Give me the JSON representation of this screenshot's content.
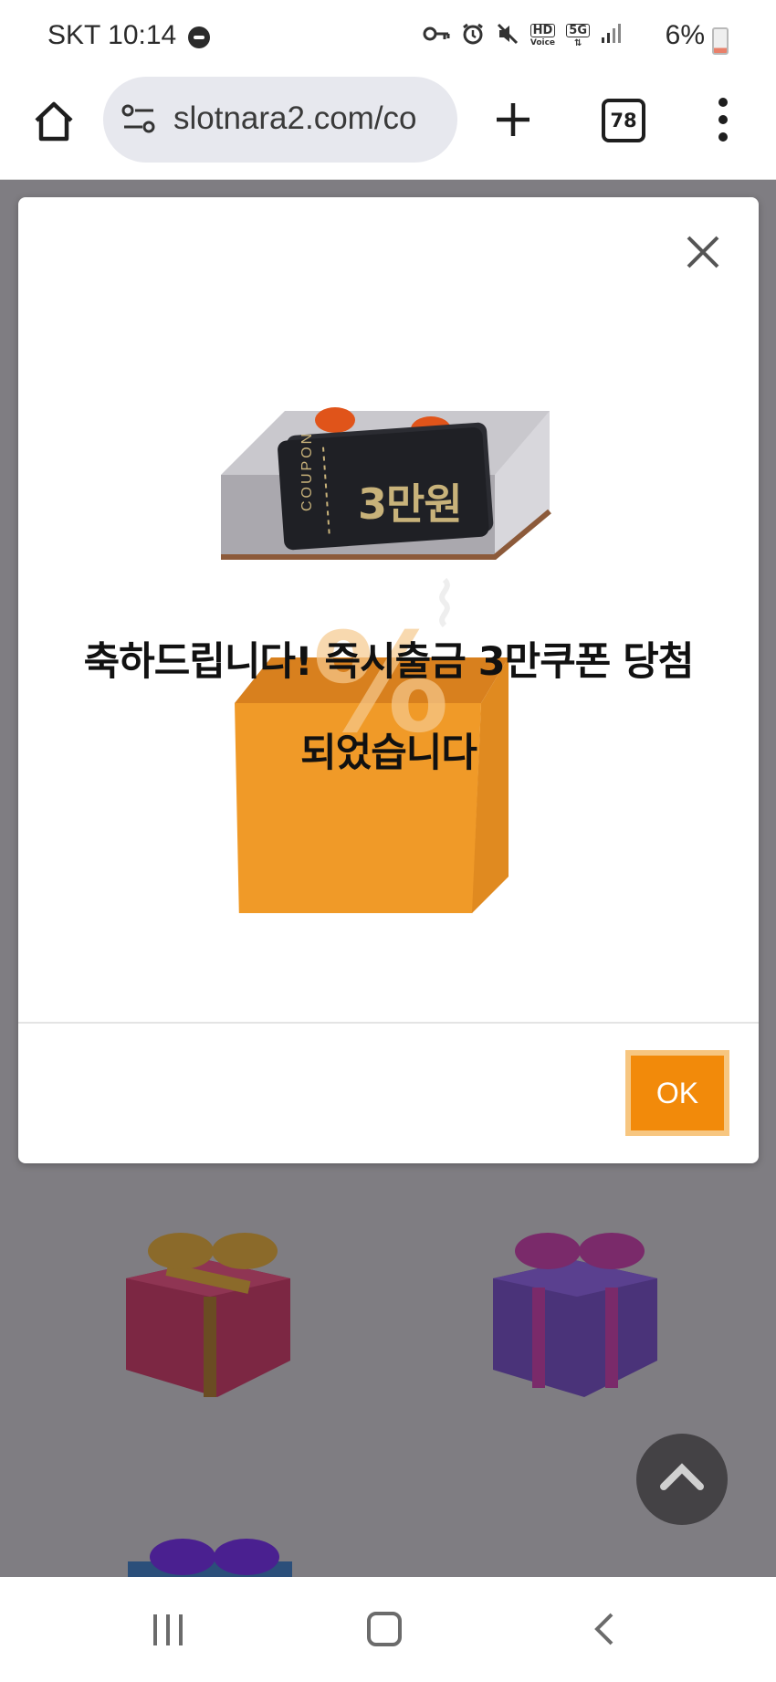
{
  "status_bar": {
    "time": "SKT 10:14",
    "battery": "6%",
    "icons": [
      "vpn-key-icon",
      "alarm-icon",
      "mute-icon",
      "hd-voice-icon",
      "5g-icon",
      "signal-icon",
      "battery-icon"
    ],
    "hd_label": "HD",
    "voice_label": "Voice",
    "network": "5G"
  },
  "browser": {
    "url": "slotnara2.com/co",
    "tab_count": "78"
  },
  "modal": {
    "coupon_label": "COUPON",
    "coupon_value": "3만원",
    "headline_line1": "축하드립니다! 즉시출금 3만쿠폰 당첨",
    "headline_line2": "되었습니다",
    "ok_label": "OK"
  },
  "colors": {
    "accent": "#f28a0a",
    "overlay": "#7f7d82"
  }
}
